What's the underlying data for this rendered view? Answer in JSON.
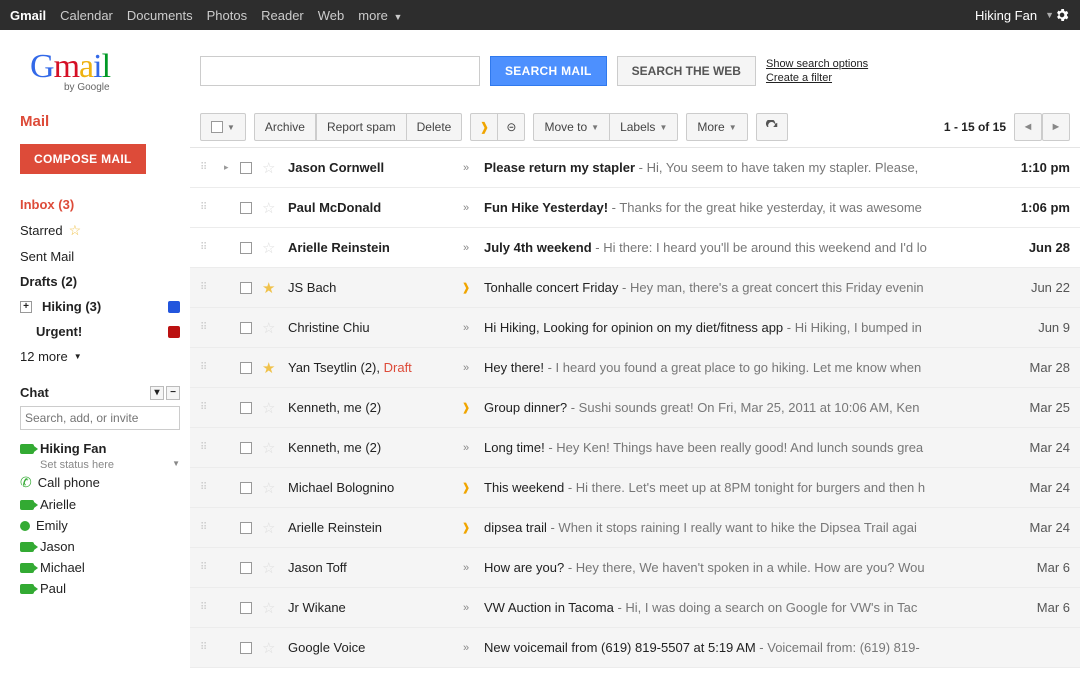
{
  "topnav": {
    "items": [
      "Gmail",
      "Calendar",
      "Documents",
      "Photos",
      "Reader",
      "Web",
      "more"
    ],
    "user": "Hiking Fan"
  },
  "logo": {
    "text": "Gmail",
    "sub": "by Google",
    "c": [
      [
        "G",
        "#3369e8"
      ],
      [
        "m",
        "#d50f25"
      ],
      [
        "a",
        "#eeb211"
      ],
      [
        "i",
        "#3369e8"
      ],
      [
        "l",
        "#009925"
      ]
    ]
  },
  "search": {
    "mail_btn": "SEARCH MAIL",
    "web_btn": "SEARCH THE WEB",
    "opt1": "Show search options",
    "opt2": "Create a filter",
    "placeholder": ""
  },
  "sidebar": {
    "title": "Mail",
    "compose": "COMPOSE MAIL",
    "items": [
      {
        "label": "Inbox (3)",
        "kind": "inbox"
      },
      {
        "label": "Starred",
        "kind": "starred"
      },
      {
        "label": "Sent Mail",
        "kind": "plain"
      },
      {
        "label": "Drafts (2)",
        "kind": "bold"
      },
      {
        "label": "Hiking (3)",
        "kind": "label",
        "color": "#2255dd",
        "exp": "+"
      },
      {
        "label": "Urgent!",
        "kind": "label",
        "color": "#bb1111",
        "indent": true
      },
      {
        "label": "12 more",
        "kind": "more"
      }
    ],
    "chat": {
      "header": "Chat",
      "search_placeholder": "Search, add, or invite",
      "me": {
        "name": "Hiking Fan",
        "status": "Set status here"
      },
      "items": [
        {
          "name": "Call phone",
          "icon": "phone"
        },
        {
          "name": "Arielle",
          "icon": "cam"
        },
        {
          "name": "Emily",
          "icon": "dot"
        },
        {
          "name": "Jason",
          "icon": "cam"
        },
        {
          "name": "Michael",
          "icon": "cam"
        },
        {
          "name": "Paul",
          "icon": "cam"
        }
      ]
    }
  },
  "toolbar": {
    "archive": "Archive",
    "spam": "Report spam",
    "delete": "Delete",
    "move": "Move to",
    "labels": "Labels",
    "more": "More",
    "page_text": "1 - 15 of 15"
  },
  "rows": [
    {
      "unread": true,
      "star": false,
      "imp": false,
      "sender": "Jason Cornwell",
      "subj": "Please return my stapler",
      "snip": " - Hi, You seem to have taken my stapler. Please,",
      "date": "1:10 pm",
      "hint": "▸"
    },
    {
      "unread": true,
      "star": false,
      "imp": false,
      "sender": "Paul McDonald",
      "subj": "Fun Hike Yesterday!",
      "snip": " - Thanks for the great hike yesterday, it was awesome",
      "date": "1:06 pm"
    },
    {
      "unread": true,
      "star": false,
      "imp": false,
      "sender": "Arielle Reinstein",
      "subj": "July 4th weekend",
      "snip": " - Hi there: I heard you'll be around this weekend and I'd lo",
      "date": "Jun 28"
    },
    {
      "unread": false,
      "star": true,
      "imp": true,
      "sender": "JS Bach",
      "subj": "Tonhalle concert Friday",
      "snip": " - Hey man, there's a great concert this Friday evenin",
      "date": "Jun 22"
    },
    {
      "unread": false,
      "star": false,
      "imp": false,
      "sender": "Christine Chiu",
      "subj": "Hi Hiking, Looking for opinion on my diet/fitness app",
      "snip": " - Hi Hiking, I bumped in",
      "date": "Jun 9"
    },
    {
      "unread": false,
      "star": true,
      "imp": false,
      "sender": "Yan Tseytlin (2), ",
      "draft": "Draft",
      "subj": "Hey there!",
      "snip": " - I heard you found a great place to go hiking. Let me know when",
      "date": "Mar 28"
    },
    {
      "unread": false,
      "star": false,
      "imp": true,
      "sender": "Kenneth, me (2)",
      "subj": "Group dinner?",
      "snip": " - Sushi sounds great! On Fri, Mar 25, 2011 at 10:06 AM, Ken",
      "date": "Mar 25"
    },
    {
      "unread": false,
      "star": false,
      "imp": false,
      "sender": "Kenneth, me (2)",
      "subj": "Long time!",
      "snip": " - Hey Ken! Things have been really good! And lunch sounds grea",
      "date": "Mar 24"
    },
    {
      "unread": false,
      "star": false,
      "imp": true,
      "sender": "Michael Bolognino",
      "subj": "This weekend",
      "snip": " - Hi there. Let's meet up at 8PM tonight for burgers and then h",
      "date": "Mar 24"
    },
    {
      "unread": false,
      "star": false,
      "imp": true,
      "sender": "Arielle Reinstein",
      "subj": "dipsea trail",
      "snip": " - When it stops raining I really want to hike the Dipsea Trail agai",
      "date": "Mar 24"
    },
    {
      "unread": false,
      "star": false,
      "imp": false,
      "sender": "Jason Toff",
      "subj": "How are you?",
      "snip": " - Hey there, We haven't spoken in a while. How are you? Wou",
      "date": "Mar 6"
    },
    {
      "unread": false,
      "star": false,
      "imp": false,
      "sender": "Jr Wikane",
      "subj": "VW Auction in Tacoma",
      "snip": " - Hi, I was doing a search on Google for VW's in Tac",
      "date": "Mar 6"
    },
    {
      "unread": false,
      "star": false,
      "imp": false,
      "sender": "Google Voice",
      "subj": "New voicemail from (619) 819-5507 at 5:19 AM",
      "snip": " - Voicemail from: (619) 819-",
      "date": ""
    }
  ]
}
